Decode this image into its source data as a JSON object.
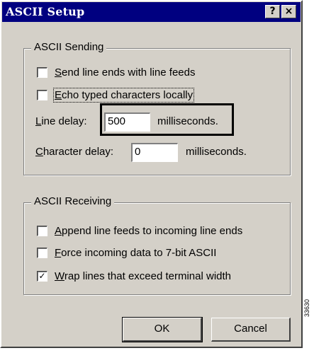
{
  "window": {
    "title": "ASCII Setup",
    "help_glyph": "?",
    "close_glyph": "×"
  },
  "sending": {
    "legend": "ASCII Sending",
    "send_line_ends": {
      "prefix": "",
      "mnemonic": "S",
      "rest": "end line ends with line feeds",
      "checked": false
    },
    "echo_typed": {
      "prefix": "",
      "mnemonic": "E",
      "rest": "cho typed characters locally",
      "checked": false
    },
    "line_delay": {
      "prefix": "",
      "mnemonic": "L",
      "rest": "ine delay:",
      "value": "500",
      "unit": "milliseconds."
    },
    "char_delay": {
      "prefix": "",
      "mnemonic": "C",
      "rest": "haracter delay:",
      "value": "0",
      "unit": "milliseconds."
    }
  },
  "receiving": {
    "legend": "ASCII Receiving",
    "append_line_feeds": {
      "mnemonic": "A",
      "rest": "ppend line feeds to incoming line ends",
      "checked": false
    },
    "force_7bit": {
      "mnemonic": "F",
      "rest": "orce incoming data to 7-bit ASCII",
      "checked": false
    },
    "wrap_lines": {
      "mnemonic": "W",
      "rest": "rap lines that exceed terminal width",
      "checked": true,
      "check_glyph": "✓"
    }
  },
  "buttons": {
    "ok": "OK",
    "cancel": "Cancel"
  },
  "figure_number": "33630"
}
